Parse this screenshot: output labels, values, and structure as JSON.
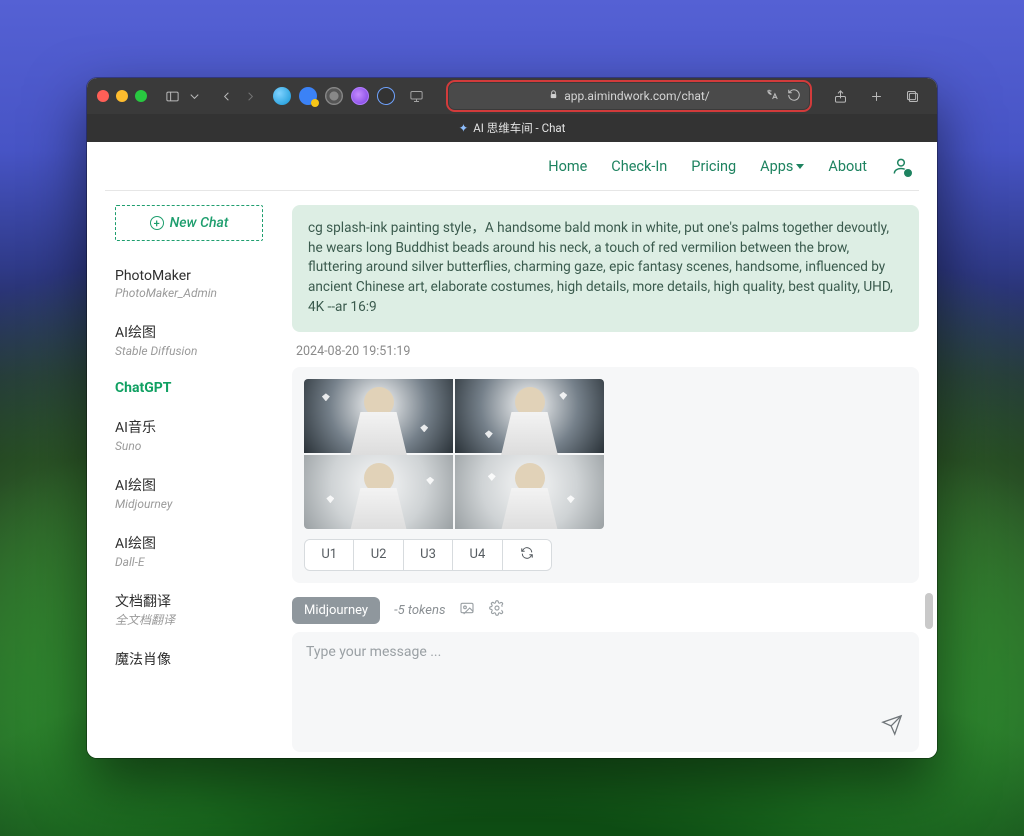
{
  "browser": {
    "url_display": "app.aimindwork.com/chat/",
    "tab_title": "AI 思维车间 - Chat"
  },
  "nav": {
    "home": "Home",
    "checkin": "Check-In",
    "pricing": "Pricing",
    "apps": "Apps",
    "about": "About"
  },
  "sidebar": {
    "new_chat": "New Chat",
    "items": [
      {
        "title": "PhotoMaker",
        "sub": "PhotoMaker_Admin"
      },
      {
        "title": "AI绘图",
        "sub": "Stable Diffusion"
      },
      {
        "title": "ChatGPT",
        "sub": ""
      },
      {
        "title": "AI音乐",
        "sub": "Suno"
      },
      {
        "title": "AI绘图",
        "sub": "Midjourney"
      },
      {
        "title": "AI绘图",
        "sub": "Dall-E"
      },
      {
        "title": "文档翻译",
        "sub": "全文档翻译"
      },
      {
        "title": "魔法肖像",
        "sub": ""
      }
    ],
    "active_index": 2
  },
  "chat": {
    "prompt": "cg splash-ink painting style，A handsome bald monk in white, put one's palms together devoutly, he wears long Buddhist beads around his neck, a touch of red vermilion between the brow, fluttering around silver butterflies, charming gaze, epic fantasy scenes, handsome, influenced by ancient Chinese art, elaborate costumes, high details, more details, high quality, best quality, UHD, 4K --ar 16:9",
    "timestamp": "2024-08-20 19:51:19",
    "buttons": {
      "u1": "U1",
      "u2": "U2",
      "u3": "U3",
      "u4": "U4"
    }
  },
  "composer": {
    "chip": "Midjourney",
    "tokens": "-5 tokens",
    "placeholder": "Type your message ..."
  }
}
